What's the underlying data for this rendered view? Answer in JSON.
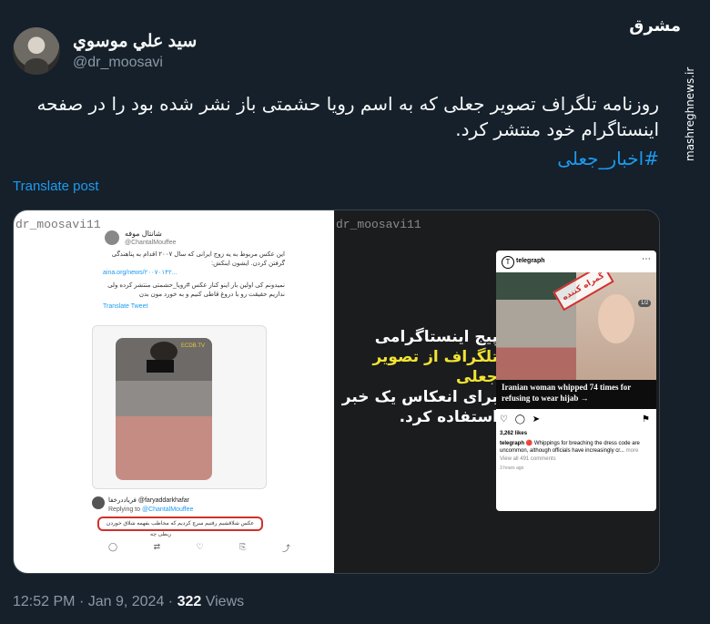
{
  "watermark": {
    "logo": "مشرق",
    "site": "mashreghnews.ir"
  },
  "author": {
    "display_name": "سيد علي موسوي",
    "handle": "@dr_moosavi"
  },
  "tweet": {
    "text": "روزنامه تلگراف تصویر جعلی که به اسم رویا حشمتی باز نشر شده بود را در صفحه اینستاگرام خود منتشر کرد.",
    "hashtag": "#اخبار_جعلی",
    "translate_label": "Translate post",
    "time": "12:52 PM",
    "date": "Jan 9, 2024",
    "views_count": "322",
    "views_label": "Views"
  },
  "media": {
    "watermark_left": "dr_moosavi11",
    "watermark_right": "dr_moosavi11",
    "inner_tweet": {
      "name": "شانتال موفه",
      "handle": "@ChantalMouffee",
      "text": "این عکس مربوط به یه زوج ایرانی که سال ۲۰۰۷ اقدام به پناهندگی گرفتن کردن. ایشون اینکش:",
      "link": "aina.org/news/۲۰۰۷۰۱۴۲...",
      "text2": "نمیدونم کی اولین بار اینو کنار عکس #رویا_حشمتی منتشر کرده ولی نداریم حقیقت رو با دروغ قاطی کنیم و به خورد مون بدن",
      "translate": "Translate Tweet",
      "photo_tag": "ECDB.TV"
    },
    "reply": {
      "name": "فریاددرخفا",
      "handle": "@faryaddarkhafar",
      "replying_prefix": "Replying to",
      "replying_handle": "@ChantalMouffee",
      "highlight": "عکس شلاقشیم رفتیم سرچ کردیم که مخاطب بفهمه شلاق خوردن",
      "extra": "ربطی چه"
    },
    "caption_line1": "پیج اینستاگرامی",
    "caption_line2": "تلگراف از تصویر جعلی",
    "caption_line3": "برای انعکاس یک خبر",
    "caption_line4": "استفاده کرد.",
    "instagram": {
      "account": "telegraph",
      "logo": "T",
      "stamp": "گمراه کننده",
      "counter": "1/2",
      "headline": "Iranian woman whipped 74 times for refusing to wear hijab →",
      "likes": "3,262 likes",
      "caption_account": "telegraph",
      "caption": "🔴 Whippings for breaching the dress code are uncommon, although officials have increasingly cr...",
      "caption_more": "more",
      "comments": "View all 491 comments",
      "time": "3 hours ago"
    }
  }
}
